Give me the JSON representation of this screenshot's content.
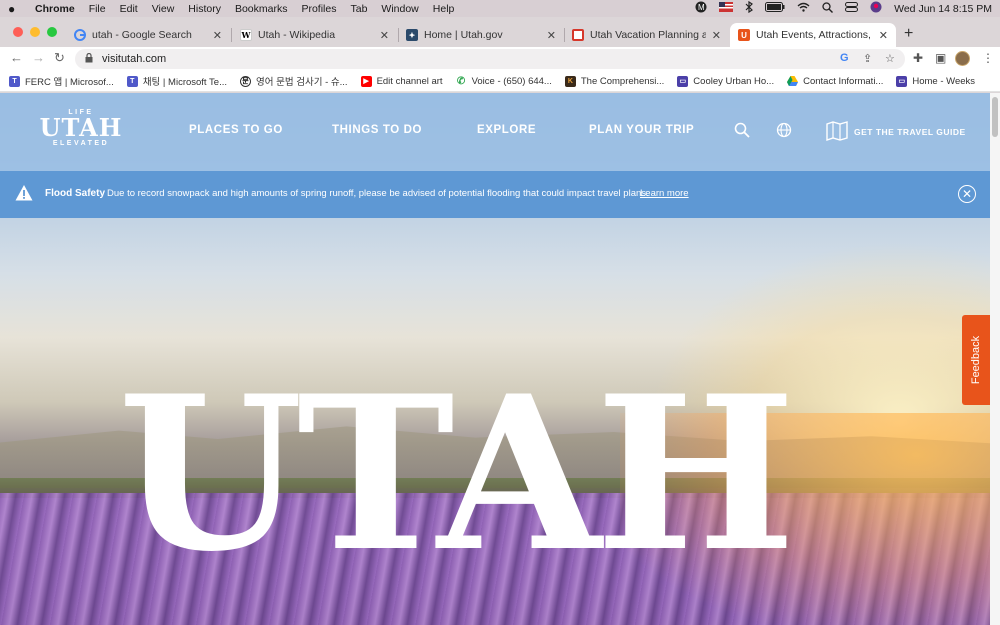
{
  "menubar": {
    "app": "Chrome",
    "items": [
      "File",
      "Edit",
      "View",
      "History",
      "Bookmarks",
      "Profiles",
      "Tab",
      "Window",
      "Help"
    ],
    "clock": "Wed Jun 14  8:15 PM"
  },
  "tabs": [
    {
      "title": "utah - Google Search",
      "favicon": "google-icon"
    },
    {
      "title": "Utah - Wikipedia",
      "favicon": "wikipedia-icon"
    },
    {
      "title": "Home | Utah.gov",
      "favicon": "utah-gov-icon"
    },
    {
      "title": "Utah Vacation Planning and Th",
      "favicon": "red-bookmark-icon"
    },
    {
      "title": "Utah Events, Attractions, Hotel",
      "favicon": "visit-utah-icon"
    }
  ],
  "toolbar": {
    "url": "visitutah.com"
  },
  "bookmarks": [
    "FERC 앱 | Microsof...",
    "채팅 | Microsoft Te...",
    "영어 문법 검사기 - 슈...",
    "Edit channel art",
    "Voice - (650) 644...",
    "The Comprehensi...",
    "Cooley Urban Ho...",
    "Contact Informati...",
    "Home - Weeks"
  ],
  "site": {
    "logo": {
      "top": "LIFE",
      "main": "UTAH",
      "bottom": "ELEVATED"
    },
    "nav": [
      "PLACES TO GO",
      "THINGS TO DO",
      "EXPLORE",
      "PLAN YOUR TRIP"
    ],
    "travel_guide": "GET THE TRAVEL GUIDE",
    "alert": {
      "title": "Flood Safety",
      "text": "Due to record snowpack and high amounts of spring runoff, please be advised of potential flooding that could impact travel plans.",
      "link": "Learn more"
    },
    "hero_title": "UTAH",
    "feedback": "Feedback"
  },
  "colors": {
    "header_bg": "#9abee4",
    "alert_bg": "#5e98d4",
    "feedback_bg": "#e8541b"
  }
}
